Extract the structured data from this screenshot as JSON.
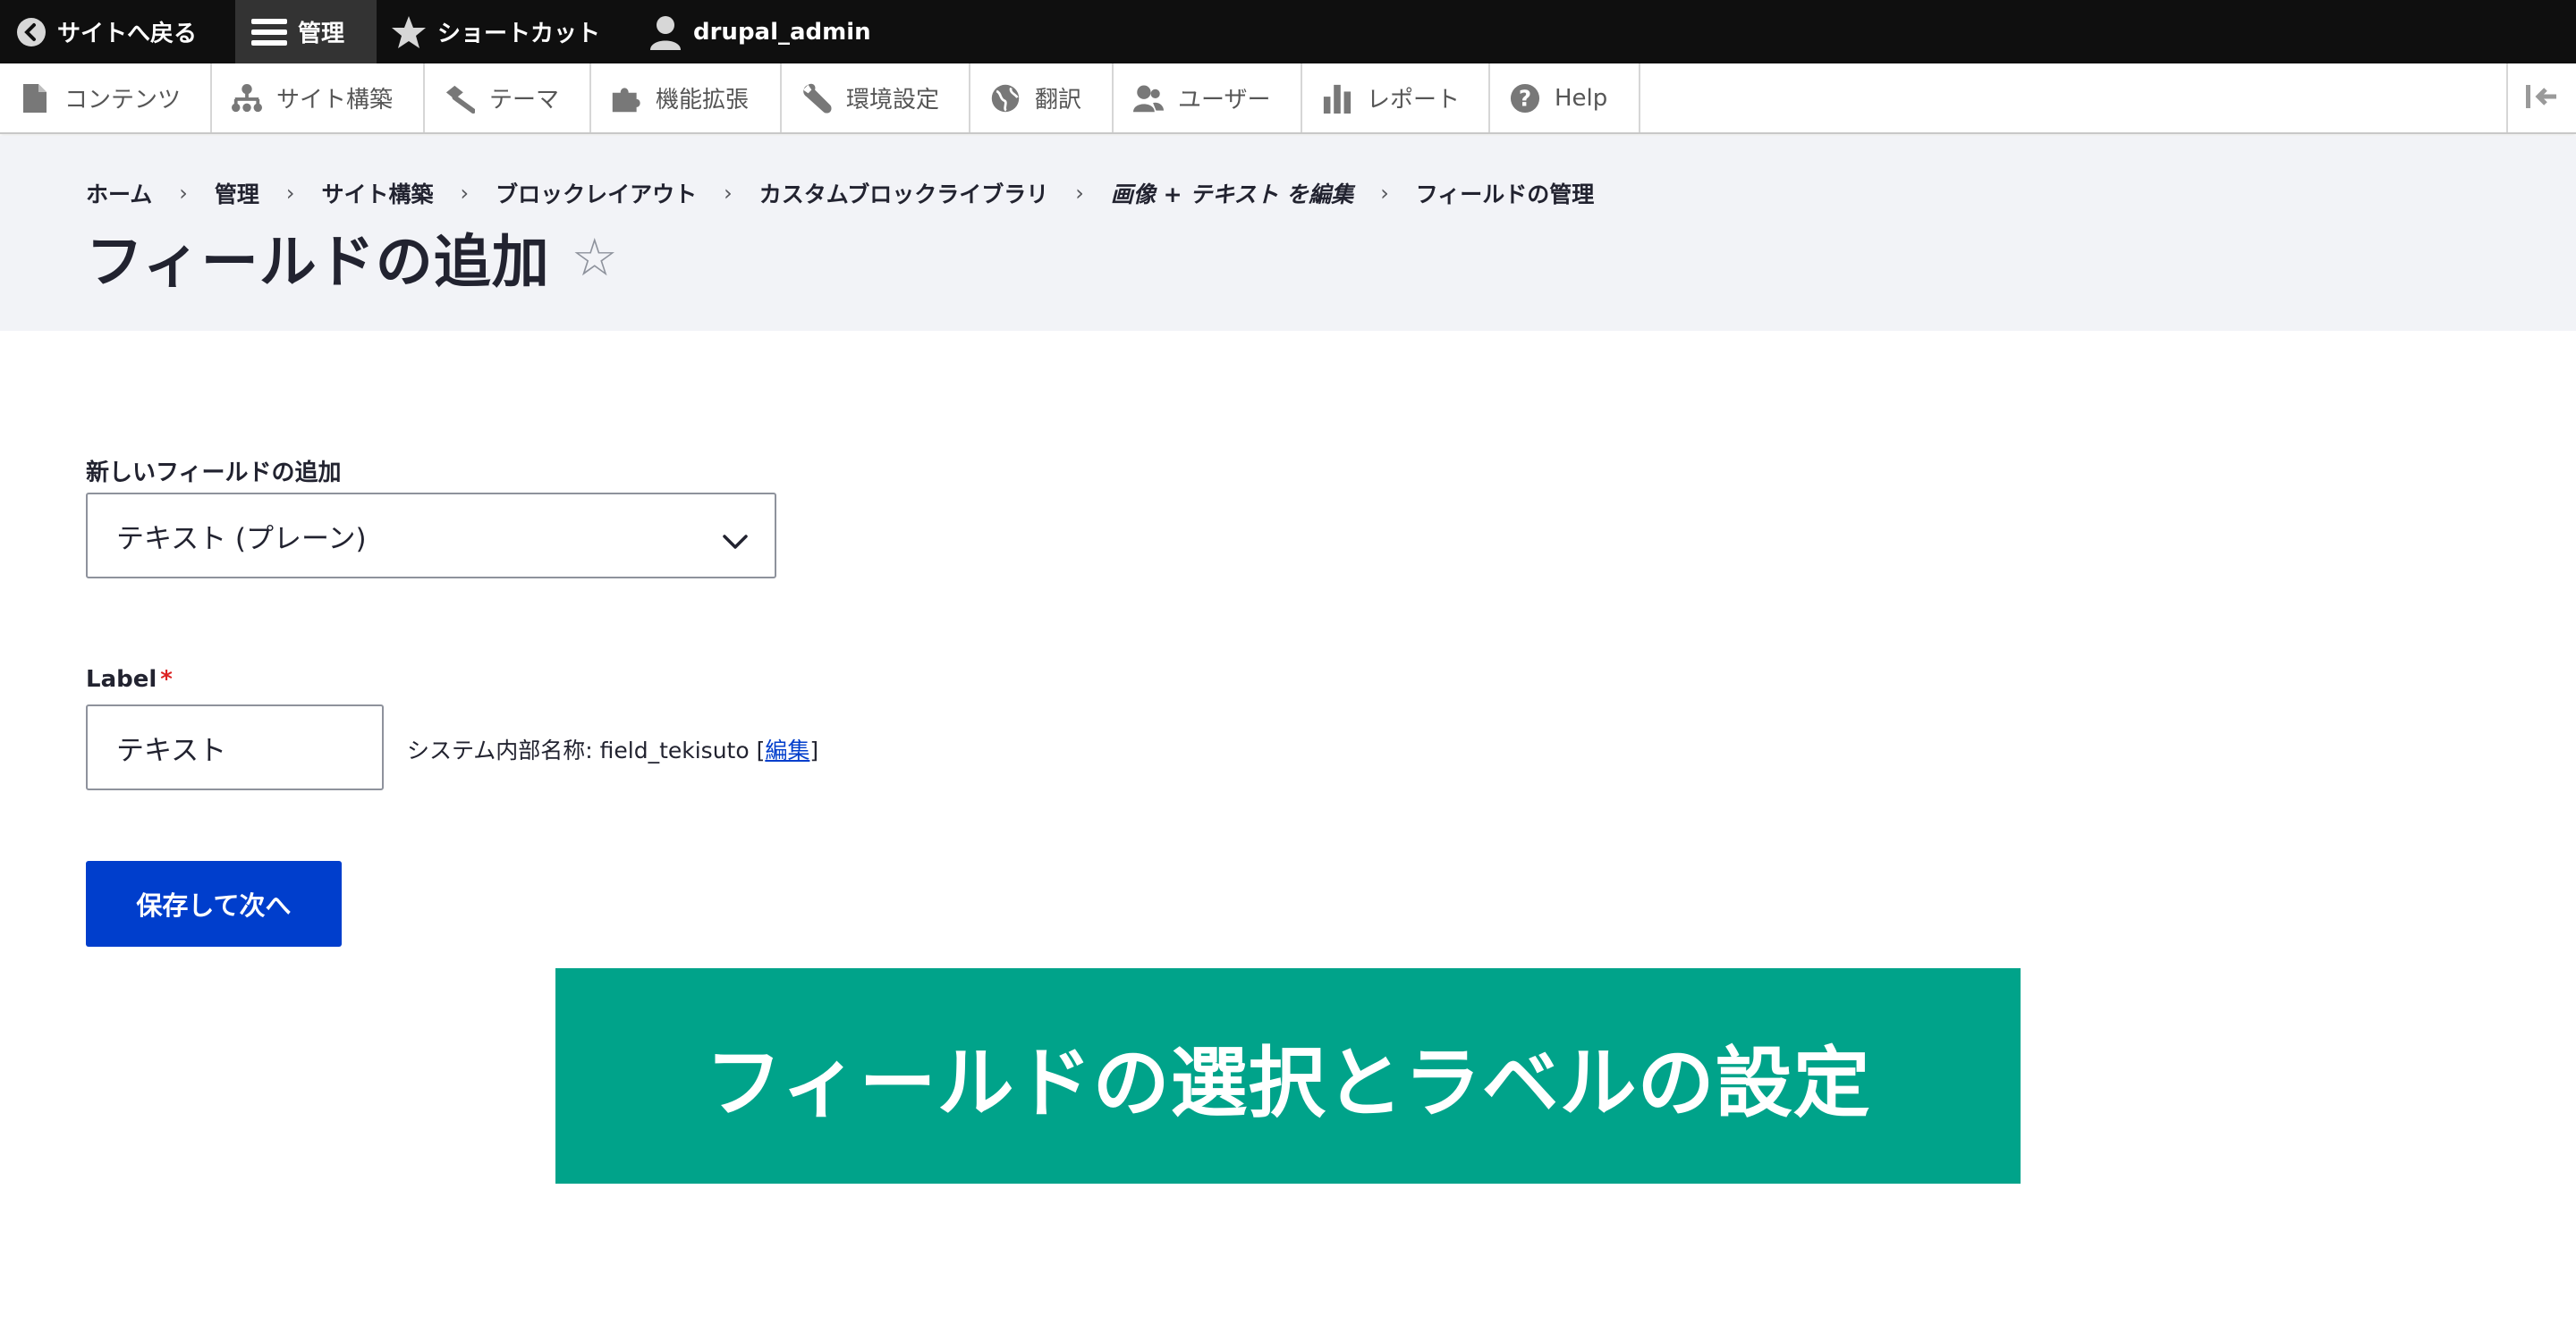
{
  "toolbar": {
    "back_label": "サイトへ戻る",
    "manage_label": "管理",
    "shortcuts_label": "ショートカット",
    "user_label": "drupal_admin"
  },
  "tray": {
    "items": [
      {
        "label": "コンテンツ",
        "icon": "file-icon"
      },
      {
        "label": "サイト構築",
        "icon": "sitemap-icon"
      },
      {
        "label": "テーマ",
        "icon": "paintbrush-icon"
      },
      {
        "label": "機能拡張",
        "icon": "puzzle-icon"
      },
      {
        "label": "環境設定",
        "icon": "wrench-icon"
      },
      {
        "label": "翻訳",
        "icon": "globe-icon"
      },
      {
        "label": "ユーザー",
        "icon": "people-icon"
      },
      {
        "label": "レポート",
        "icon": "bar-chart-icon"
      },
      {
        "label": "Help",
        "icon": "help-icon"
      }
    ]
  },
  "breadcrumb": [
    "ホーム",
    "管理",
    "サイト構築",
    "ブロックレイアウト",
    "カスタムブロックライブラリ",
    "画像 + テキスト を編集",
    "フィールドの管理"
  ],
  "page": {
    "title": "フィールドの追加"
  },
  "form": {
    "new_field_label": "新しいフィールドの追加",
    "new_field_value": "テキスト (プレーン)",
    "label_label": "Label",
    "required_marker": "*",
    "label_value": "テキスト",
    "machine_name_prefix": "システム内部名称: field_tekisuto [",
    "machine_name_edit": "編集",
    "machine_name_suffix": "]",
    "submit_label": "保存して次へ"
  },
  "banner": {
    "text": "フィールドの選択とラベルの設定"
  },
  "colors": {
    "primary": "#003ecc",
    "banner": "#00a38a",
    "toolbar": "#0f0f0f",
    "header_bg": "#f2f3f7",
    "required": "#dc2323"
  }
}
